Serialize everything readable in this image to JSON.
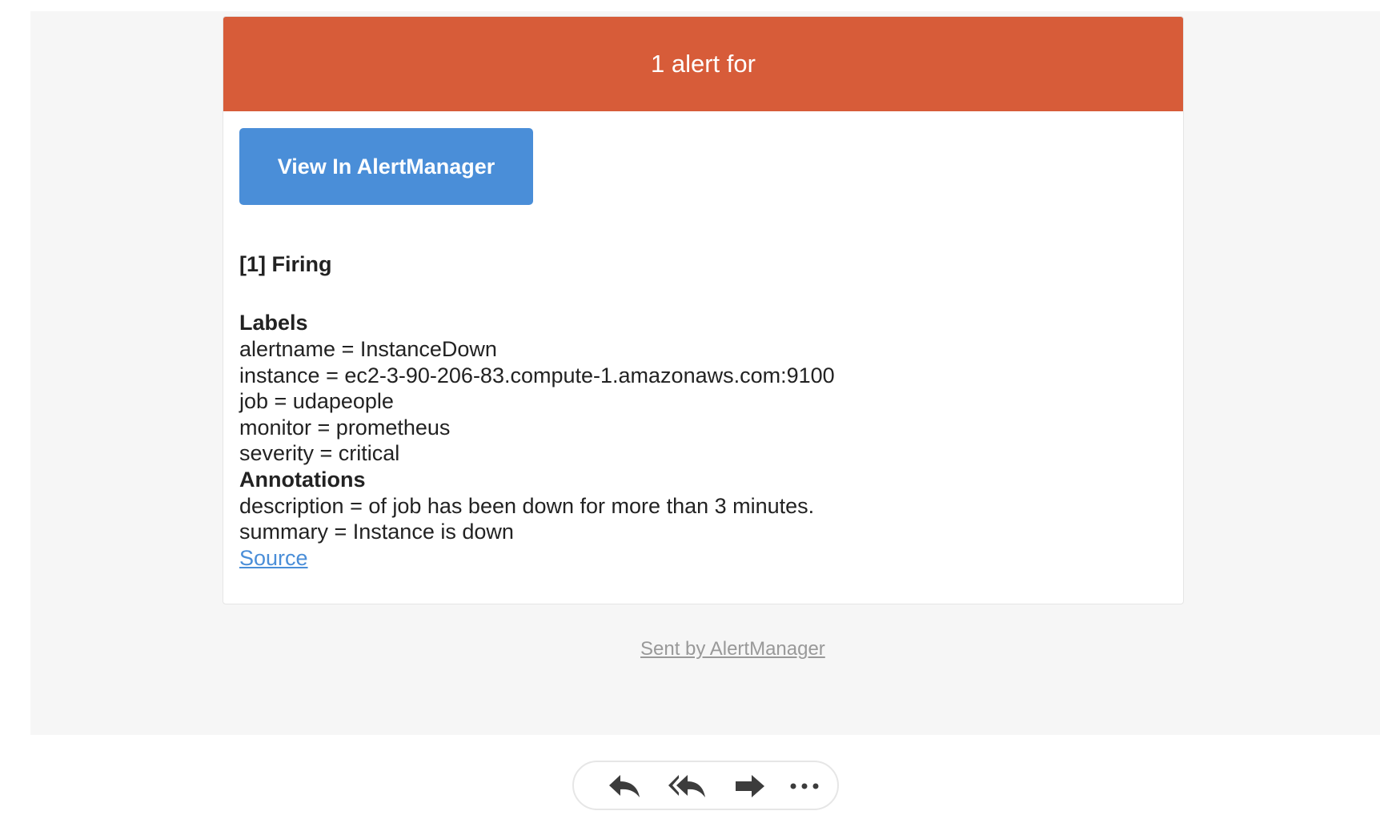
{
  "email": {
    "header_title": "1 alert for",
    "header_color": "#d75c39",
    "view_button_label": "View In AlertManager",
    "view_button_color": "#4a8ed8",
    "firing_title": "[1] Firing",
    "labels_heading": "Labels",
    "labels": [
      "alertname = InstanceDown",
      "instance = ec2-3-90-206-83.compute-1.amazonaws.com:9100",
      "job = udapeople",
      "monitor = prometheus",
      "severity = critical"
    ],
    "annotations_heading": "Annotations",
    "annotations": [
      "description = of job has been down for more than 3 minutes.",
      "summary = Instance is down"
    ],
    "source_link": "Source",
    "footer_link": "Sent by AlertManager"
  },
  "actions": [
    {
      "name": "reply",
      "icon": "reply-icon"
    },
    {
      "name": "reply-all",
      "icon": "reply-all-icon"
    },
    {
      "name": "forward",
      "icon": "forward-icon"
    },
    {
      "name": "more",
      "icon": "more-icon"
    }
  ]
}
